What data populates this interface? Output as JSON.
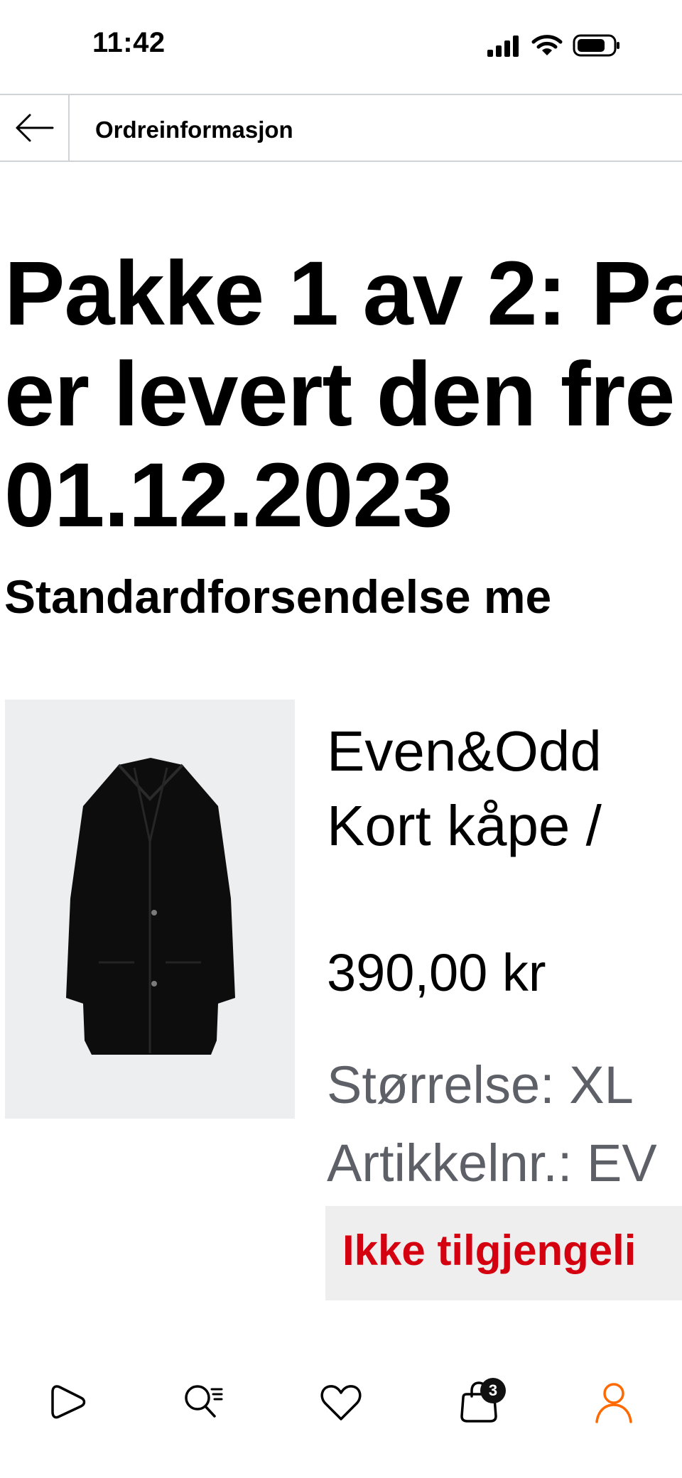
{
  "status_bar": {
    "time": "11:42"
  },
  "header": {
    "title": "Ordreinformasjon"
  },
  "package": {
    "heading_line1": "Pakke 1 av 2: Pa",
    "heading_line2": "er levert den fre",
    "heading_line3": "01.12.2023",
    "shipping": "Standardforsendelse me"
  },
  "product": {
    "brand": "Even&Odd",
    "name": "Kort kåpe /",
    "price": "390,00 kr",
    "size": "Størrelse: XL",
    "article_no": "Artikkelnr.: EV",
    "availability": "Ikke tilgjengeli"
  },
  "tabbar": {
    "bag_count": "3"
  },
  "colors": {
    "accent": "#ff6900",
    "error": "#d5000f",
    "muted": "#5d6067"
  }
}
